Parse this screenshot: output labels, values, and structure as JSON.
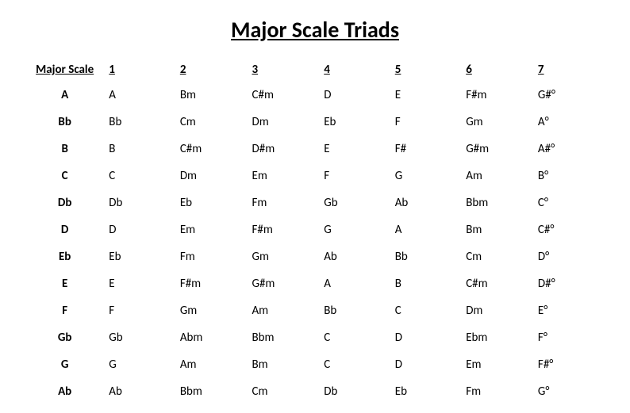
{
  "title": "Major Scale Triads",
  "chart_data": {
    "type": "table",
    "title": "Major Scale Triads",
    "headers": [
      "Major Scale",
      "1",
      "2",
      "3",
      "4",
      "5",
      "6",
      "7"
    ],
    "rows": [
      [
        "A",
        "A",
        "Bm",
        "C#m",
        "D",
        "E",
        "F#m",
        "G#°"
      ],
      [
        "Bb",
        "Bb",
        "Cm",
        "Dm",
        "Eb",
        "F",
        "Gm",
        "A°"
      ],
      [
        "B",
        "B",
        "C#m",
        "D#m",
        "E",
        "F#",
        "G#m",
        "A#°"
      ],
      [
        "C",
        "C",
        "Dm",
        "Em",
        "F",
        "G",
        "Am",
        "B°"
      ],
      [
        "Db",
        "Db",
        "Eb",
        "Fm",
        "Gb",
        "Ab",
        "Bbm",
        "C°"
      ],
      [
        "D",
        "D",
        "Em",
        "F#m",
        "G",
        "A",
        "Bm",
        "C#°"
      ],
      [
        "Eb",
        "Eb",
        "Fm",
        "Gm",
        "Ab",
        "Bb",
        "Cm",
        "D°"
      ],
      [
        "E",
        "E",
        "F#m",
        "G#m",
        "A",
        "B",
        "C#m",
        "D#°"
      ],
      [
        "F",
        "F",
        "Gm",
        "Am",
        "Bb",
        "C",
        "Dm",
        "E°"
      ],
      [
        "Gb",
        "Gb",
        "Abm",
        "Bbm",
        "C",
        "D",
        "Ebm",
        "F°"
      ],
      [
        "G",
        "G",
        "Am",
        "Bm",
        "C",
        "D",
        "Em",
        "F#°"
      ],
      [
        "Ab",
        "Ab",
        "Bbm",
        "Cm",
        "Db",
        "Eb",
        "Fm",
        "G°"
      ]
    ]
  }
}
